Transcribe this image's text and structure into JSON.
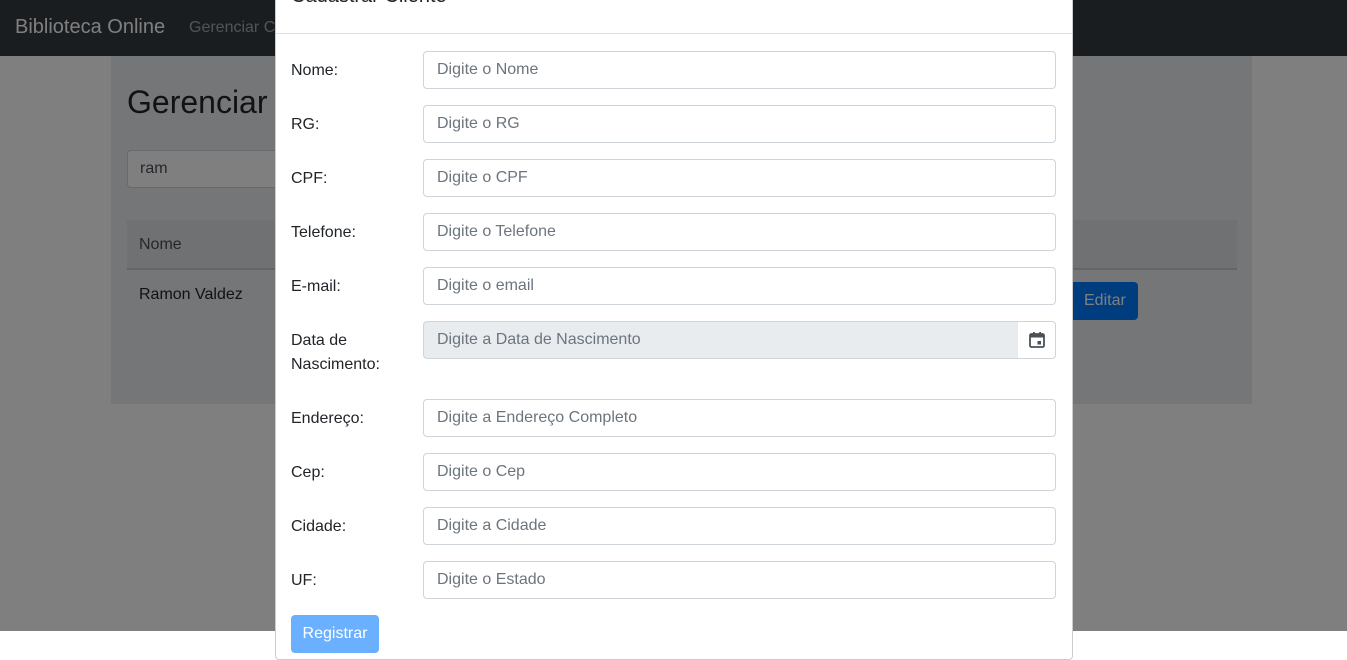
{
  "navbar": {
    "brand": "Biblioteca Online",
    "link": "Gerenciar Cl"
  },
  "page": {
    "title": "Gerenciar",
    "search_value": "ram",
    "table": {
      "header_name": "Nome",
      "rows": [
        {
          "name": "Ramon Valdez",
          "edit_label": "Editar"
        }
      ]
    }
  },
  "modal": {
    "title": "Cadastrar Cliente",
    "fields": [
      {
        "label": "Nome:",
        "placeholder": "Digite o Nome"
      },
      {
        "label": "RG:",
        "placeholder": "Digite o RG"
      },
      {
        "label": "CPF:",
        "placeholder": "Digite o CPF"
      },
      {
        "label": "Telefone:",
        "placeholder": "Digite o Telefone"
      },
      {
        "label": "E-mail:",
        "placeholder": "Digite o email"
      },
      {
        "label_line1": "Data de",
        "label_line2": "Nascimento:",
        "placeholder": "Digite a Data de Nascimento"
      },
      {
        "label": "Endereço:",
        "placeholder": "Digite a Endereço Completo"
      },
      {
        "label": "Cep:",
        "placeholder": "Digite o Cep"
      },
      {
        "label": "Cidade:",
        "placeholder": "Digite a Cidade"
      },
      {
        "label": "UF:",
        "placeholder": "Digite o Estado"
      }
    ],
    "submit_label": "Registrar"
  },
  "colors": {
    "navbar": "#343a40",
    "primary": "#007bff",
    "backdrop": "rgba(0,0,0,0.5)"
  },
  "icons": {
    "calendar": "calendar-icon"
  }
}
